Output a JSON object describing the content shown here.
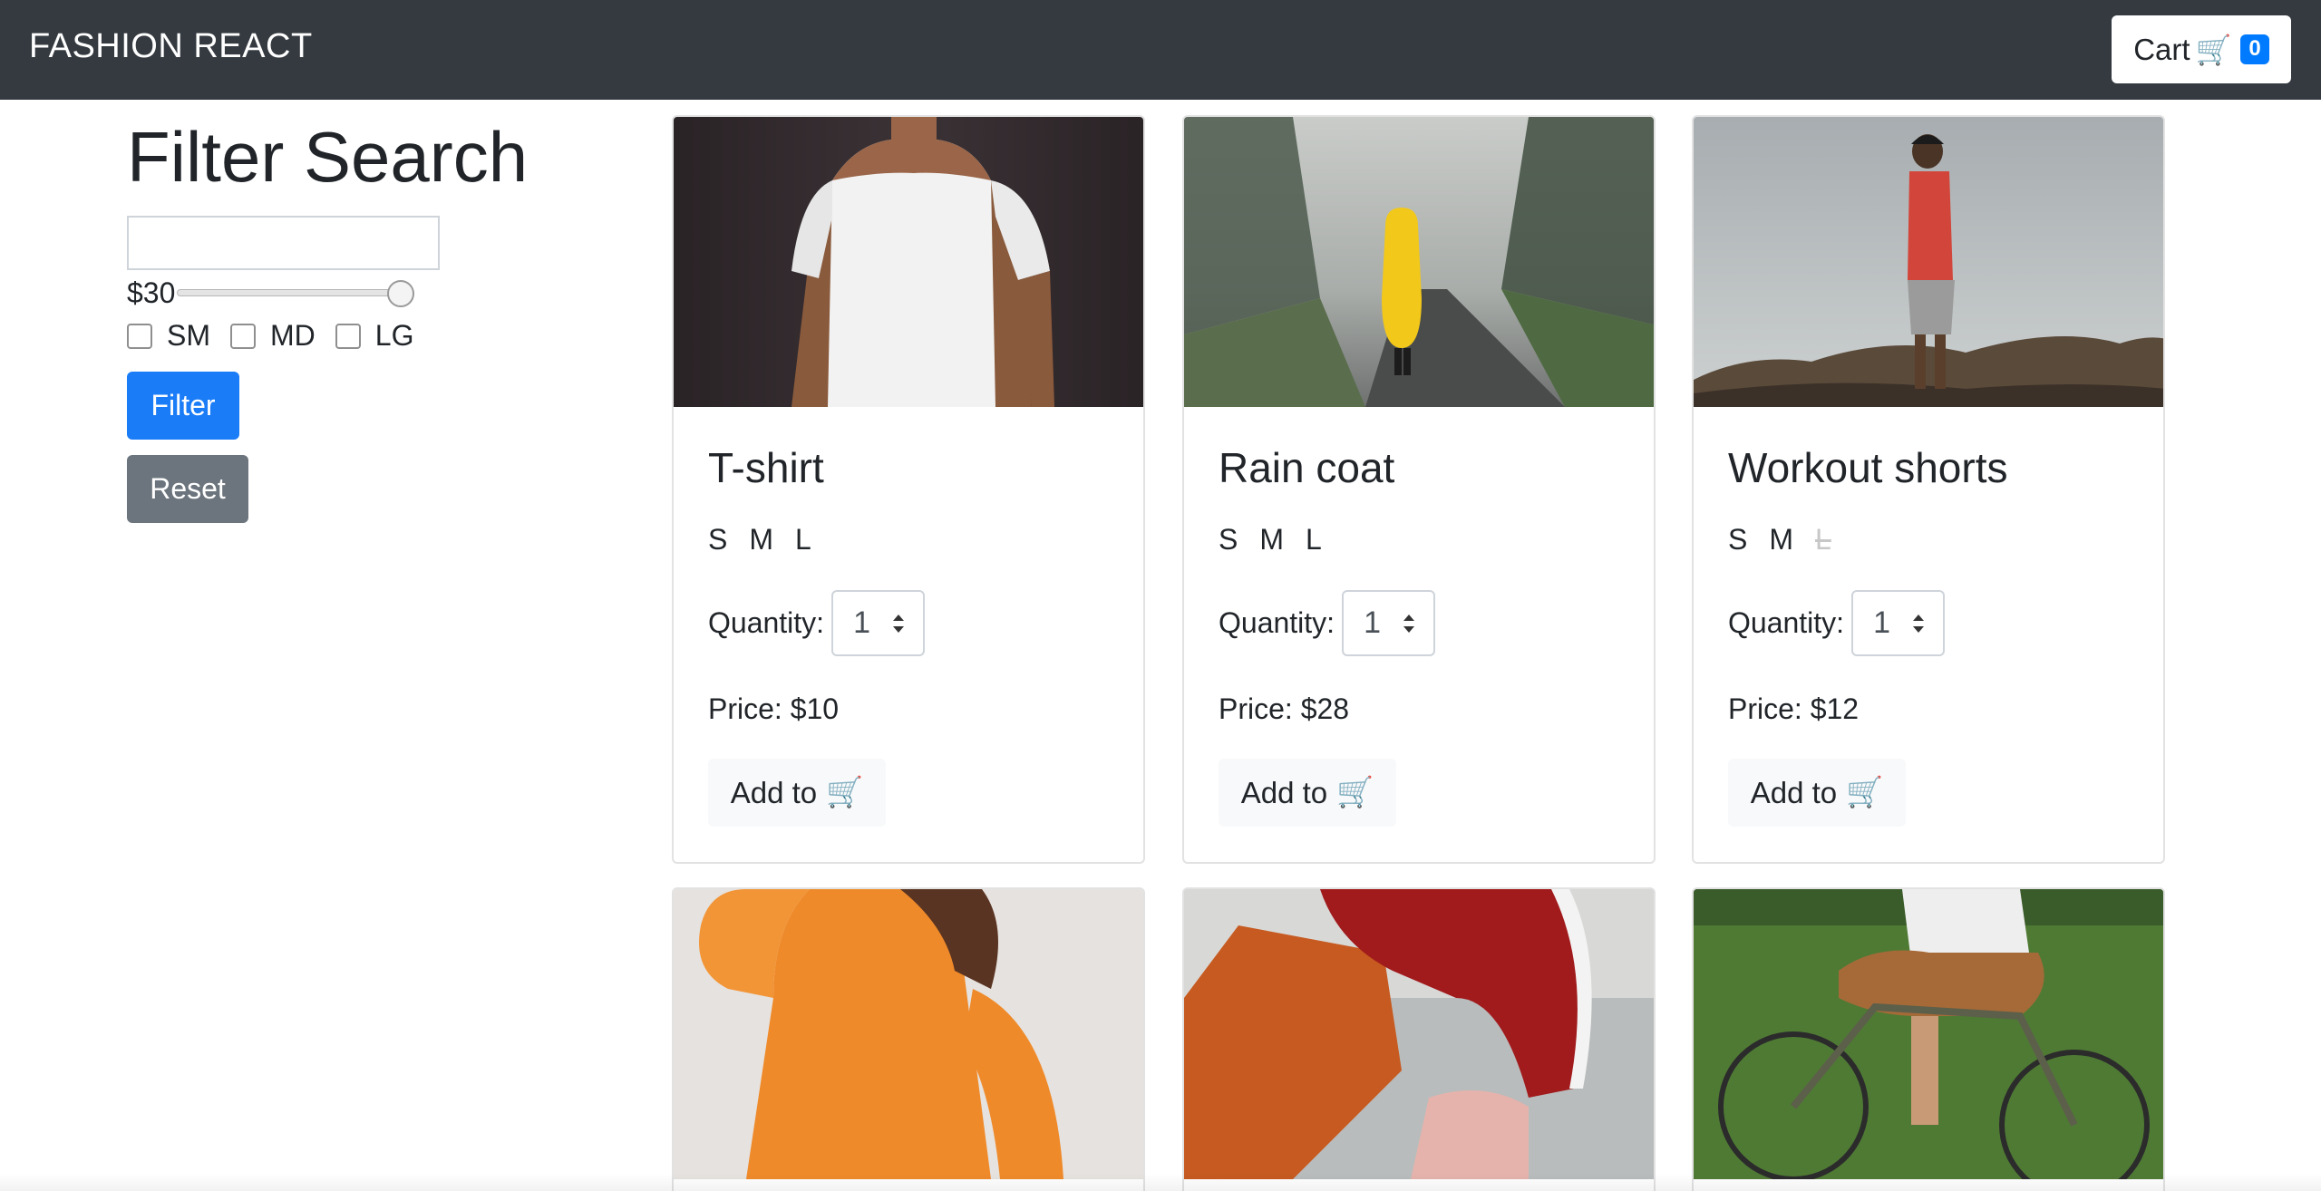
{
  "navbar": {
    "brand": "FASHION REACT",
    "cart_label": "Cart",
    "cart_icon": "shopping-cart-icon",
    "cart_count": "0"
  },
  "sidebar": {
    "title": "Filter Search",
    "search_value": "",
    "price_label": "$30",
    "price_slider_fraction": 1.0,
    "sizes": [
      "SM",
      "MD",
      "LG"
    ],
    "filter_button": "Filter",
    "reset_button": "Reset"
  },
  "products": [
    {
      "name": "T-shirt",
      "sizes": [
        "S",
        "M",
        "L"
      ],
      "unavailable_sizes": [],
      "quantity_label": "Quantity:",
      "quantity": "1",
      "price": "Price: $10",
      "add_label": "Add to"
    },
    {
      "name": "Rain coat",
      "sizes": [
        "S",
        "M",
        "L"
      ],
      "unavailable_sizes": [],
      "quantity_label": "Quantity:",
      "quantity": "1",
      "price": "Price: $28",
      "add_label": "Add to"
    },
    {
      "name": "Workout shorts",
      "sizes": [
        "S",
        "M",
        "L"
      ],
      "unavailable_sizes": [
        "L"
      ],
      "quantity_label": "Quantity:",
      "quantity": "1",
      "price": "Price: $12",
      "add_label": "Add to"
    }
  ],
  "colors": {
    "navbar_bg": "#343a40",
    "primary": "#1a7cf7",
    "secondary": "#6c757d"
  }
}
